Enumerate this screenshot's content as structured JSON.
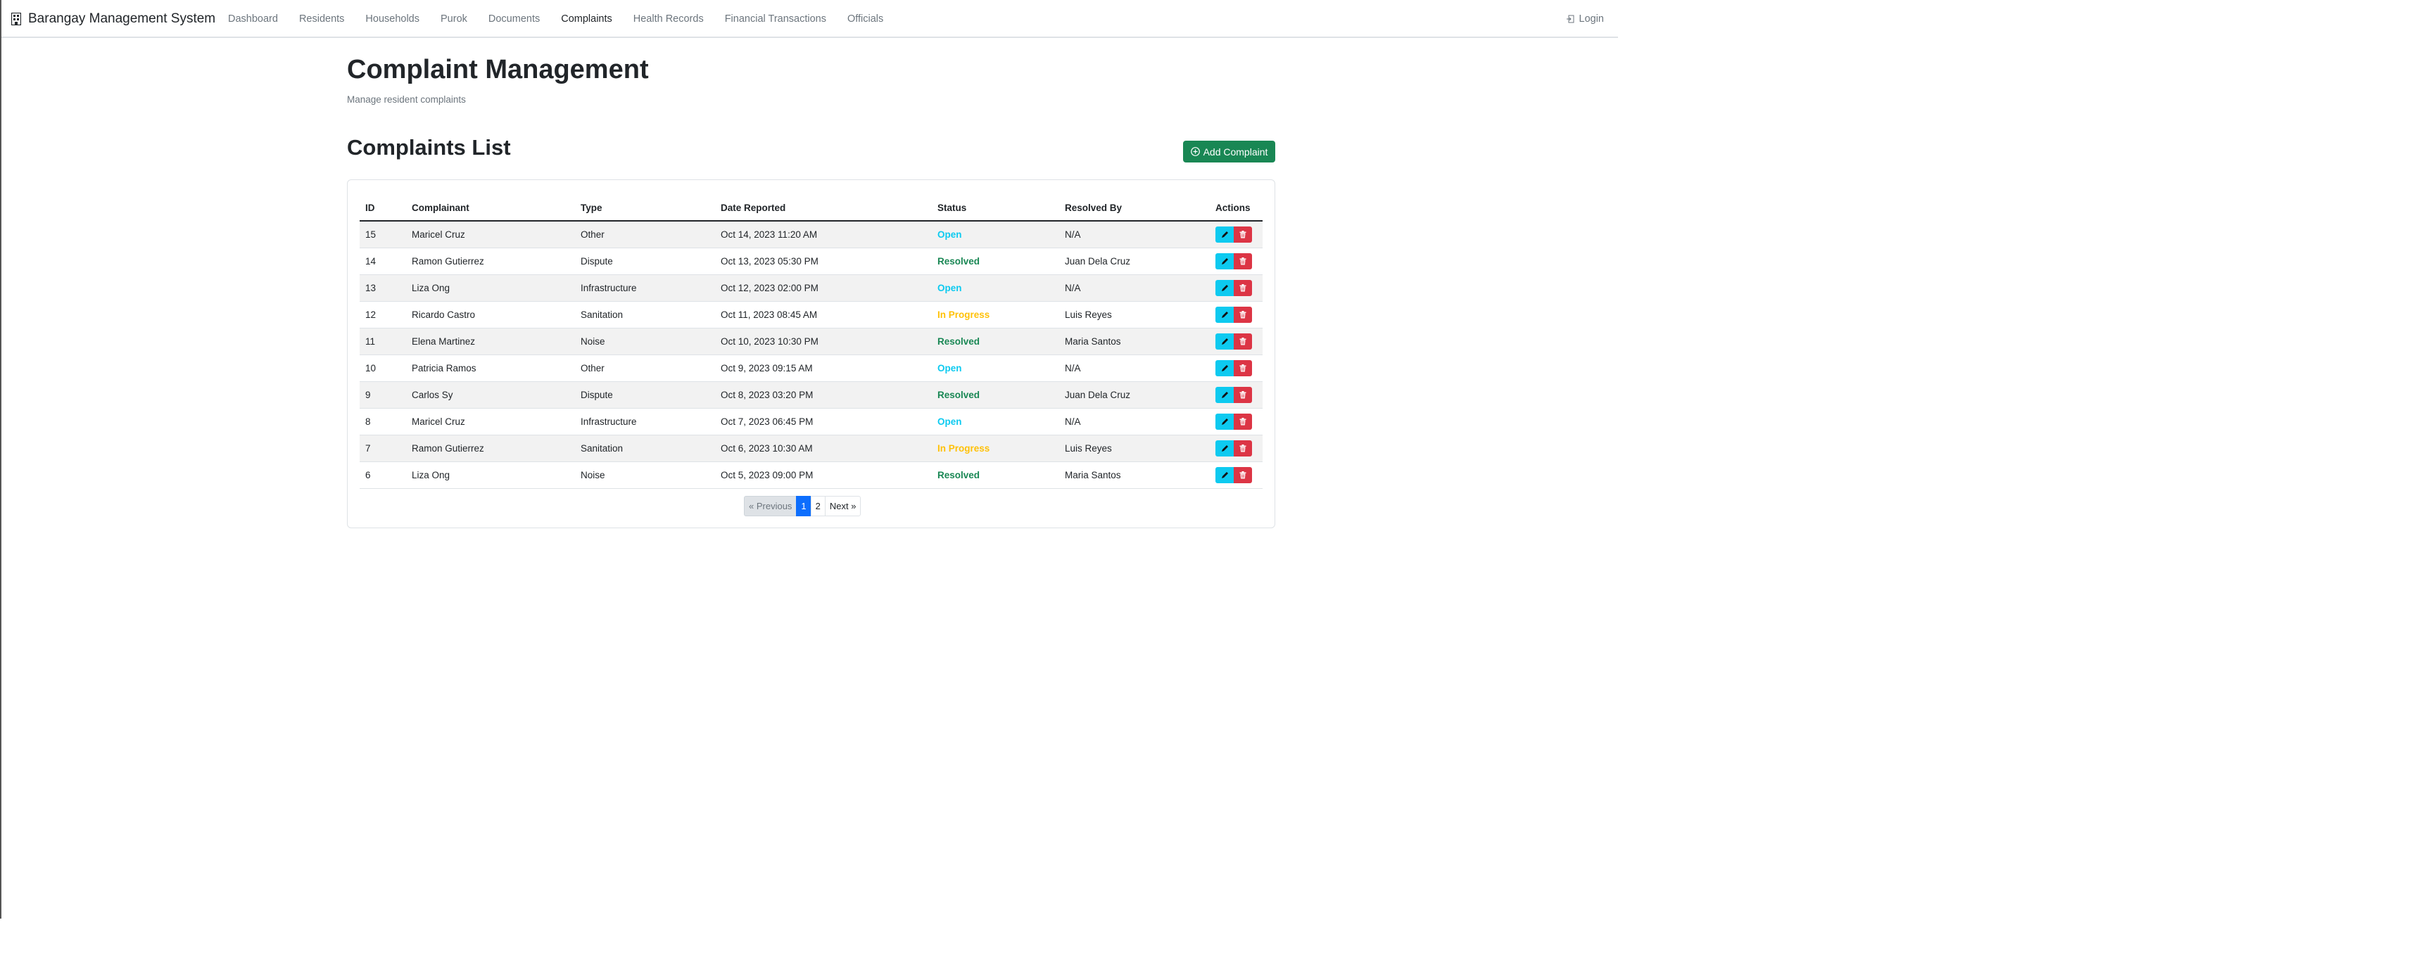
{
  "navbar": {
    "brand": "Barangay Management System",
    "items": [
      "Dashboard",
      "Residents",
      "Households",
      "Purok",
      "Documents",
      "Complaints",
      "Health Records",
      "Financial Transactions",
      "Officials"
    ],
    "active": "Complaints",
    "login_label": "Login"
  },
  "page": {
    "title": "Complaint Management",
    "subtitle": "Manage resident complaints"
  },
  "section": {
    "title": "Complaints List",
    "add_button": "Add Complaint"
  },
  "table": {
    "headers": [
      "ID",
      "Complainant",
      "Type",
      "Date Reported",
      "Status",
      "Resolved By",
      "Actions"
    ],
    "rows": [
      {
        "id": "15",
        "complainant": "Maricel Cruz",
        "type": "Other",
        "date": "Oct 14, 2023 11:20 AM",
        "status": "Open",
        "resolved_by": "N/A"
      },
      {
        "id": "14",
        "complainant": "Ramon Gutierrez",
        "type": "Dispute",
        "date": "Oct 13, 2023 05:30 PM",
        "status": "Resolved",
        "resolved_by": "Juan Dela Cruz"
      },
      {
        "id": "13",
        "complainant": "Liza Ong",
        "type": "Infrastructure",
        "date": "Oct 12, 2023 02:00 PM",
        "status": "Open",
        "resolved_by": "N/A"
      },
      {
        "id": "12",
        "complainant": "Ricardo Castro",
        "type": "Sanitation",
        "date": "Oct 11, 2023 08:45 AM",
        "status": "In Progress",
        "resolved_by": "Luis Reyes"
      },
      {
        "id": "11",
        "complainant": "Elena Martinez",
        "type": "Noise",
        "date": "Oct 10, 2023 10:30 PM",
        "status": "Resolved",
        "resolved_by": "Maria Santos"
      },
      {
        "id": "10",
        "complainant": "Patricia Ramos",
        "type": "Other",
        "date": "Oct 9, 2023 09:15 AM",
        "status": "Open",
        "resolved_by": "N/A"
      },
      {
        "id": "9",
        "complainant": "Carlos Sy",
        "type": "Dispute",
        "date": "Oct 8, 2023 03:20 PM",
        "status": "Resolved",
        "resolved_by": "Juan Dela Cruz"
      },
      {
        "id": "8",
        "complainant": "Maricel Cruz",
        "type": "Infrastructure",
        "date": "Oct 7, 2023 06:45 PM",
        "status": "Open",
        "resolved_by": "N/A"
      },
      {
        "id": "7",
        "complainant": "Ramon Gutierrez",
        "type": "Sanitation",
        "date": "Oct 6, 2023 10:30 AM",
        "status": "In Progress",
        "resolved_by": "Luis Reyes"
      },
      {
        "id": "6",
        "complainant": "Liza Ong",
        "type": "Noise",
        "date": "Oct 5, 2023 09:00 PM",
        "status": "Resolved",
        "resolved_by": "Maria Santos"
      }
    ]
  },
  "status_colors": {
    "Open": "#0dcaf0",
    "Resolved": "#198754",
    "In Progress": "#ffc107"
  },
  "icons": {
    "edit": "pencil-icon",
    "delete": "trash-icon",
    "add": "plus-circle-icon",
    "login": "login-icon",
    "brand": "building-icon"
  },
  "pagination": {
    "previous": "« Previous",
    "pages": [
      "1",
      "2"
    ],
    "current": "1",
    "next": "Next »"
  }
}
